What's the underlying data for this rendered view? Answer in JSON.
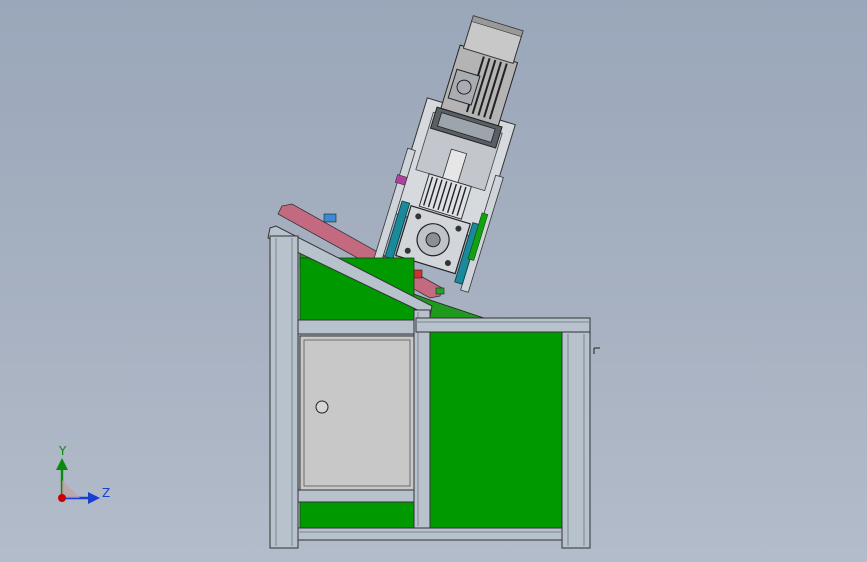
{
  "viewport": {
    "background_top": "#9aa7ba",
    "background_bottom": "#b3bcca"
  },
  "model": {
    "frame_color": "#b7c2cc",
    "panel_color": "#009900",
    "door_color": "#c8c8c8",
    "motor_color": "#b4b4b4",
    "accent_blue": "#1a8a9a",
    "accent_pink": "#c0607a"
  },
  "triad": {
    "x_color": "#cc0000",
    "y_label": "Y",
    "y_color": "#0a8a0a",
    "z_label": "Z",
    "z_color": "#1a3fd0"
  }
}
